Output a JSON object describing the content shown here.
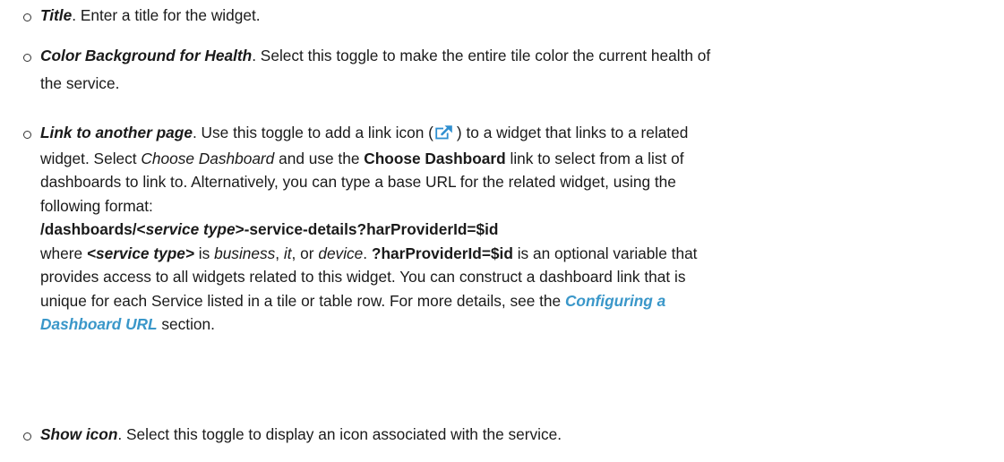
{
  "items": [
    {
      "term": "Title",
      "text": ". Enter a title for the widget."
    },
    {
      "term": "Color Background for Health",
      "text1": ". Select this toggle to make the entire tile color the current health of",
      "text2": "the service."
    },
    {
      "term": "Link to another page",
      "line1_a": ". Use this toggle to add a link icon (",
      "line1_b": ") to a widget that links to a related",
      "line2_a": "widget. Select ",
      "line2_italic": "Choose Dashboard",
      "line2_b": " and use the ",
      "line2_bold": "Choose Dashboard",
      "line2_c": " link to select from a list of",
      "line3": "dashboards to link to. Alternatively, you can type a base URL for the related widget, using the",
      "line4": "following format:",
      "url_a": "/dashboards/<",
      "url_italic": "service type",
      "url_b": ">-service-details?harProviderId=$id",
      "line6_a": "where ",
      "line6_bi": "<service type>",
      "line6_b": " is ",
      "line6_i1": "business",
      "line6_c": ", ",
      "line6_i2": "it",
      "line6_d": ", or ",
      "line6_i3": "device",
      "line6_e": ". ",
      "line6_bold": "?harProviderId=$id",
      "line6_f": " is an optional variable that",
      "line7": "provides access to all widgets related to this widget. You can construct a dashboard link that is",
      "line8_a": "unique for each Service listed in a tile or table row. For more details, see the ",
      "xref_part1": "Configuring a",
      "xref_part2": "Dashboard URL",
      "line9_b": " section."
    },
    {
      "term": "Show icon",
      "text": ". Select this toggle to display an icon associated with the service."
    }
  ],
  "colors": {
    "text": "#1a1a1a",
    "xref": "#3a97c9",
    "icon": "#2f8fd0"
  },
  "icons": {
    "link": "external-link-icon",
    "bullet": "hollow-circle-bullet-icon"
  }
}
